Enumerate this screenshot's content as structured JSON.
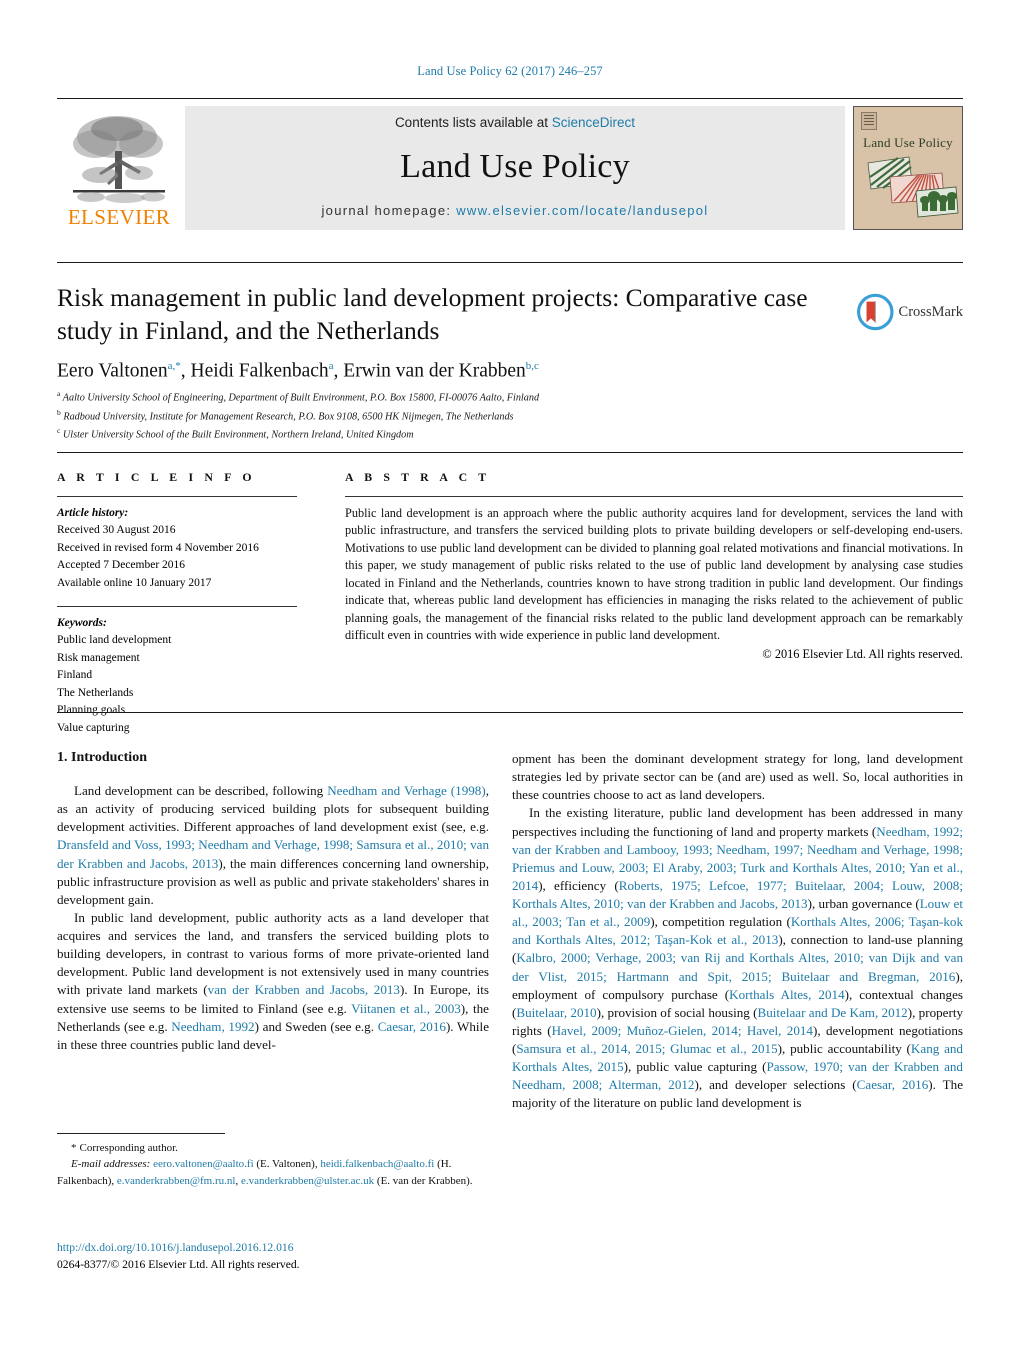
{
  "running_head": "Land Use Policy 62 (2017) 246–257",
  "masthead": {
    "publisher_name": "ELSEVIER",
    "contents_prefix": "Contents lists available at ",
    "contents_link": "ScienceDirect",
    "journal_title": "Land Use Policy",
    "homepage_prefix": "journal homepage: ",
    "homepage_link": "www.elsevier.com/locate/landusepol",
    "cover_title": "Land Use Policy"
  },
  "article": {
    "title": "Risk management in public land development projects: Comparative case study in Finland, and the Netherlands",
    "crossmark_label": "CrossMark",
    "authors_html": "Eero Valtonen<sup>a,*</sup>, Heidi Falkenbach<sup>a</sup>, Erwin van der Krabben<sup>b,c</sup>",
    "affiliations": [
      {
        "marker": "a",
        "text": "Aalto University School of Engineering, Department of Built Environment, P.O. Box 15800, FI-00076 Aalto, Finland"
      },
      {
        "marker": "b",
        "text": "Radboud University, Institute for Management Research, P.O. Box 9108, 6500 HK Nijmegen, The Netherlands"
      },
      {
        "marker": "c",
        "text": "Ulster University School of the Built Environment, Northern Ireland, United Kingdom"
      }
    ]
  },
  "article_info": {
    "heading": "A R T I C L E   I N F O",
    "history_label": "Article history:",
    "history": [
      "Received 30 August 2016",
      "Received in revised form 4 November 2016",
      "Accepted 7 December 2016",
      "Available online 10 January 2017"
    ],
    "keywords_label": "Keywords:",
    "keywords": [
      "Public land development",
      "Risk management",
      "Finland",
      "The Netherlands",
      "Planning goals",
      "Value capturing"
    ]
  },
  "abstract": {
    "heading": "A B S T R A C T",
    "text": "Public land development is an approach where the public authority acquires land for development, services the land with public infrastructure, and transfers the serviced building plots to private building developers or self-developing end-users. Motivations to use public land development can be divided to planning goal related motivations and financial motivations. In this paper, we study management of public risks related to the use of public land development by analysing case studies located in Finland and the Netherlands, countries known to have strong tradition in public land development. Our findings indicate that, whereas public land development has efficiencies in managing the risks related to the achievement of public planning goals, the management of the financial risks related to the public land development approach can be remarkably difficult even in countries with wide experience in public land development.",
    "copyright": "© 2016 Elsevier Ltd. All rights reserved."
  },
  "body": {
    "section_heading": "1. Introduction",
    "left_paragraph_1_html": "Land development can be described, following <span class=\"lnk\">Needham and Verhage (1998)</span>, as an activity of producing serviced building plots for subsequent building development activities. Different approaches of land development exist (see, e.g. <span class=\"lnk\">Dransfeld and Voss, 1993; Needham and Verhage, 1998; Samsura et al., 2010; van der Krabben and Jacobs, 2013</span>), the main differences concerning land ownership, public infrastructure provision as well as public and private stakeholders' shares in development gain.",
    "left_paragraph_2_html": "In public land development, public authority acts as a land developer that acquires and services the land, and transfers the serviced building plots to building developers, in contrast to various forms of more private-oriented land development. Public land development is not extensively used in many countries with private land markets (<span class=\"lnk\">van der Krabben and Jacobs, 2013</span>). In Europe, its extensive use seems to be limited to Finland (see e.g. <span class=\"lnk\">Viitanen et al., 2003</span>), the Netherlands (see e.g. <span class=\"lnk\">Needham, 1992</span>) and Sweden (see e.g. <span class=\"lnk\">Caesar, 2016</span>). While in these three countries public land devel-",
    "right_paragraph_1_html": "opment has been the dominant development strategy for long, land development strategies led by private sector can be (and are) used as well. So, local authorities in these countries choose to act as land developers.",
    "right_paragraph_2_html": "In the existing literature, public land development has been addressed in many perspectives including the functioning of land and property markets (<span class=\"lnk\">Needham, 1992; van der Krabben and Lambooy, 1993; Needham, 1997; Needham and Verhage, 1998; Priemus and Louw, 2003; El Araby, 2003; Turk and Korthals Altes, 2010; Yan et al., 2014</span>), efficiency (<span class=\"lnk\">Roberts, 1975; Lefcoe, 1977; Buitelaar, 2004; Louw, 2008; Korthals Altes, 2010; van der Krabben and Jacobs, 2013</span>), urban governance (<span class=\"lnk\">Louw et al., 2003; Tan et al., 2009</span>), competition regulation (<span class=\"lnk\">Korthals Altes, 2006; Taşan-kok and Korthals Altes, 2012; Taşan-Kok et al., 2013</span>), connection to land-use planning (<span class=\"lnk\">Kalbro, 2000; Verhage, 2003; van Rij and Korthals Altes, 2010; van Dijk and van der Vlist, 2015; Hartmann and Spit, 2015; Buitelaar and Bregman, 2016</span>), employment of compulsory purchase (<span class=\"lnk\">Korthals Altes, 2014</span>), contextual changes (<span class=\"lnk\">Buitelaar, 2010</span>), provision of social housing (<span class=\"lnk\">Buitelaar and De Kam, 2012</span>), property rights (<span class=\"lnk\">Havel, 2009; Muñoz-Gielen, 2014; Havel, 2014</span>), development negotiations (<span class=\"lnk\">Samsura et al., 2014, 2015; Glumac et al., 2015</span>), public accountability (<span class=\"lnk\">Kang and Korthals Altes, 2015</span>), public value capturing (<span class=\"lnk\">Passow, 1970; van der Krabben and Needham, 2008; Alterman, 2012</span>), and developer selections (<span class=\"lnk\">Caesar, 2016</span>). The majority of the literature on public land development is"
  },
  "footnotes": {
    "corresponding_marker": "*",
    "corresponding_text": "Corresponding author.",
    "email_label": "E-mail addresses:",
    "emails_html": "<span class=\"lnk\">eero.valtonen@aalto.fi</span> (E. Valtonen), <span class=\"lnk\">heidi.falkenbach@aalto.fi</span> (H. Falkenbach), <span class=\"lnk\">e.vanderkrabben@fm.ru.nl</span>, <span class=\"lnk\">e.vanderkrabben@ulster.ac.uk</span> (E. van der Krabben).",
    "doi_url": "http://dx.doi.org/10.1016/j.landusepol.2016.12.016",
    "issn_line": "0264-8377/© 2016 Elsevier Ltd. All rights reserved."
  },
  "colors": {
    "link_blue": "#1f7ba8",
    "elsevier_orange": "#f08000",
    "masthead_gray": "#e9e9e9",
    "cover_tan": "#d9c3a8",
    "crossmark_red": "#d8402f",
    "crossmark_blue": "#3a9fd6"
  }
}
